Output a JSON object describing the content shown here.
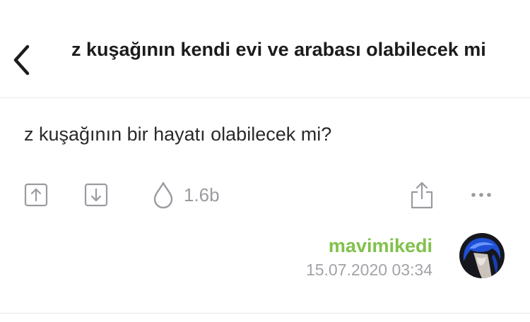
{
  "header": {
    "title": "z kuşağının kendi evi ve arabası olabilecek mi",
    "back_icon": "chevron-left-icon"
  },
  "entry": {
    "text": "z kuşağının bir hayatı olabilecek mi?"
  },
  "actions": {
    "upvote_icon": "upvote-icon",
    "downvote_icon": "downvote-icon",
    "favorite_icon": "drop-icon",
    "favorite_count": "1.6b",
    "share_icon": "share-icon",
    "more_icon": "more-icon"
  },
  "author": {
    "name": "mavimikedi",
    "date": "15.07.2020 03:34",
    "name_color": "#81c14b"
  }
}
